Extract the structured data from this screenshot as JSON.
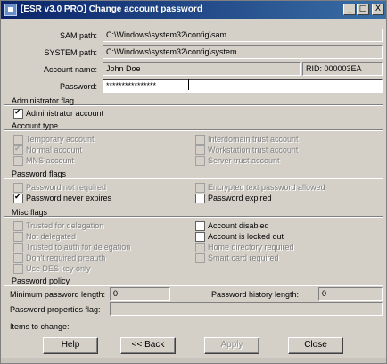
{
  "window": {
    "title": "[ESR v3.0 PRO]  Change account password",
    "min_glyph": "_",
    "max_glyph": "□",
    "close_glyph": "X"
  },
  "paths": {
    "sam_label": "SAM path:",
    "sam_value": "C:\\Windows\\system32\\config\\sam",
    "system_label": "SYSTEM path:",
    "system_value": "C:\\Windows\\system32\\config\\system"
  },
  "account": {
    "name_label": "Account name:",
    "name_value": "John Doe",
    "rid": "RID: 000003EA",
    "password_label": "Password:",
    "password_value": "****************"
  },
  "admin_flag": {
    "section": "Administrator flag",
    "admin_account": {
      "label": "Administrator account",
      "checked": true,
      "enabled": true
    }
  },
  "account_type": {
    "section": "Account type",
    "items": [
      {
        "label": "Temporary account",
        "checked": false,
        "enabled": false
      },
      {
        "label": "Normal account",
        "checked": true,
        "enabled": false
      },
      {
        "label": "MNS account",
        "checked": false,
        "enabled": false
      },
      {
        "label": "Interdomain trust account",
        "checked": false,
        "enabled": false
      },
      {
        "label": "Workstation trust account",
        "checked": false,
        "enabled": false
      },
      {
        "label": "Server trust account",
        "checked": false,
        "enabled": false
      }
    ]
  },
  "password_flags": {
    "section": "Password flags",
    "items": [
      {
        "label": "Password not required",
        "checked": false,
        "enabled": false
      },
      {
        "label": "Password never expires",
        "checked": true,
        "enabled": true
      },
      {
        "label": "Encrypted text password allowed",
        "checked": false,
        "enabled": false
      },
      {
        "label": "Password expired",
        "checked": false,
        "enabled": true
      }
    ]
  },
  "misc_flags": {
    "section": "Misc flags",
    "items": [
      {
        "label": "Trusted for delegation",
        "checked": false,
        "enabled": false
      },
      {
        "label": "Not delegated",
        "checked": false,
        "enabled": false
      },
      {
        "label": "Trusted to auth for delegation",
        "checked": false,
        "enabled": false
      },
      {
        "label": "Don't required preauth",
        "checked": false,
        "enabled": false
      },
      {
        "label": "Use DES key only",
        "checked": false,
        "enabled": false
      },
      {
        "label": "Account disabled",
        "checked": false,
        "enabled": true
      },
      {
        "label": "Account is locked out",
        "checked": false,
        "enabled": true
      },
      {
        "label": "Home directory required",
        "checked": false,
        "enabled": false
      },
      {
        "label": "Smart card required",
        "checked": false,
        "enabled": false
      }
    ]
  },
  "policy": {
    "section": "Password policy",
    "min_len_label": "Minimum password length:",
    "min_len_value": "0",
    "history_label": "Password history length:",
    "history_value": "0",
    "props_label": "Password properties flag:",
    "props_value": ""
  },
  "footer": {
    "items_to_change": "Items to change:",
    "help": "Help",
    "back": "<< Back",
    "apply": "Apply",
    "close": "Close"
  }
}
